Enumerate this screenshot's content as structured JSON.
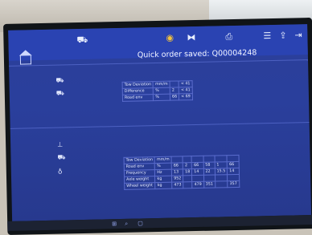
{
  "header": {
    "title": "Quick order saved: Q00004248",
    "icons": [
      "truck-icon",
      "circle-icon",
      "axle-icon",
      "printer-icon",
      "list-icon",
      "export-icon",
      "exit-icon"
    ]
  },
  "upper_panel": {
    "row_label": "Tow Deviation",
    "row_unit": "mm/m",
    "row_value": "< 41",
    "rows": [
      {
        "label": "Difference",
        "unit": "%",
        "v1": "2",
        "v2": "< 41"
      },
      {
        "label": "Road env",
        "unit": "%",
        "v1": "66",
        "v2": "< 69"
      }
    ]
  },
  "lower_panel": {
    "header_label": "Tow Deviation",
    "header_unit": "mm/m",
    "rows": [
      {
        "label": "Road env",
        "unit": "%",
        "cells": [
          "66",
          "2",
          "66",
          "58",
          "1",
          "66"
        ]
      },
      {
        "label": "Frequency",
        "unit": "Hz",
        "cells": [
          "13",
          "18",
          "14",
          "22",
          "15.5",
          "14"
        ]
      },
      {
        "label": "Axle weight",
        "unit": "kg",
        "cells": [
          "952",
          "",
          "",
          "",
          "",
          ""
        ]
      },
      {
        "label": "Wheel weight",
        "unit": "kg",
        "cells": [
          "473",
          "",
          "479",
          "351",
          "",
          "357"
        ]
      }
    ]
  }
}
